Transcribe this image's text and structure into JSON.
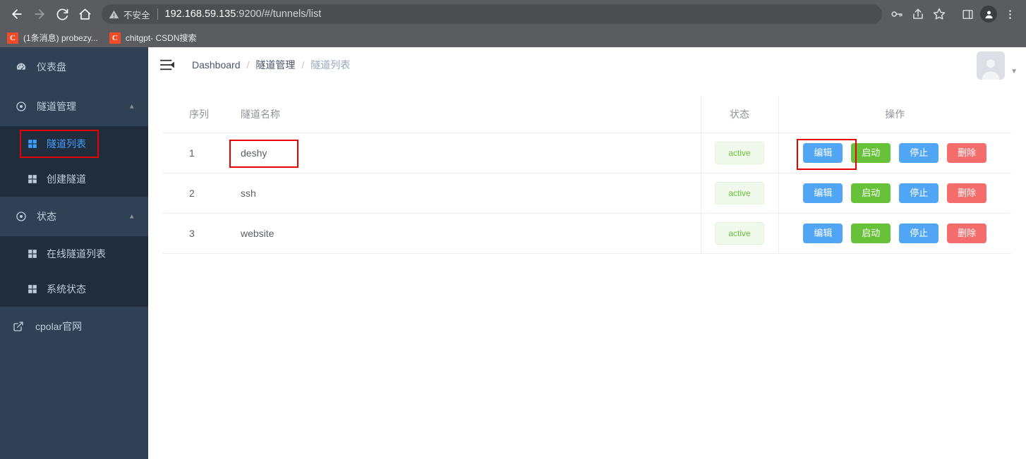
{
  "browser": {
    "nav": {
      "back": "back-arrow",
      "forward": "forward-arrow",
      "reload": "reload",
      "home": "home"
    },
    "omnibox": {
      "security_label": "不安全",
      "url_host": "192.168.59.135",
      "url_path": ":9200/#/tunnels/list"
    },
    "toolbar_icons": [
      "key-icon",
      "share-icon",
      "star-icon",
      "sidepanel-icon",
      "profile-icon",
      "more-menu-icon"
    ],
    "bookmarks": [
      {
        "favicon_letter": "C",
        "title": "(1条消息) probezy..."
      },
      {
        "favicon_letter": "C",
        "title": "chitgpt- CSDN搜索"
      }
    ]
  },
  "sidebar": {
    "items": [
      {
        "label": "仪表盘",
        "icon": "dashboard-icon",
        "type": "item"
      },
      {
        "label": "隧道管理",
        "icon": "tunnel-icon",
        "type": "group",
        "expanded": true
      },
      {
        "label": "隧道列表",
        "icon": "grid-icon",
        "type": "sub",
        "active": true
      },
      {
        "label": "创建隧道",
        "icon": "grid-icon",
        "type": "sub",
        "active": false
      },
      {
        "label": "状态",
        "icon": "tunnel-icon",
        "type": "group",
        "expanded": true
      },
      {
        "label": "在线隧道列表",
        "icon": "grid-icon",
        "type": "sub",
        "active": false
      },
      {
        "label": "系统状态",
        "icon": "grid-icon",
        "type": "sub",
        "active": false
      },
      {
        "label": "cpolar官网",
        "icon": "external-link-icon",
        "type": "external"
      }
    ]
  },
  "navbar": {
    "hamburger": "hamburger-icon",
    "breadcrumb": [
      {
        "label": "Dashboard",
        "current": false
      },
      {
        "label": "隧道管理",
        "current": false
      },
      {
        "label": "隧道列表",
        "current": true
      }
    ],
    "separator": "/",
    "avatar": "user-avatar",
    "caret": "caret-down-icon"
  },
  "table": {
    "columns": [
      "序列",
      "隧道名称",
      "状态",
      "操作"
    ],
    "rows": [
      {
        "index": "1",
        "name": "deshy",
        "status": "active",
        "actions": [
          "编辑",
          "启动",
          "停止",
          "删除"
        ]
      },
      {
        "index": "2",
        "name": "ssh",
        "status": "active",
        "actions": [
          "编辑",
          "启动",
          "停止",
          "删除"
        ]
      },
      {
        "index": "3",
        "name": "website",
        "status": "active",
        "actions": [
          "编辑",
          "启动",
          "停止",
          "删除"
        ]
      }
    ]
  },
  "colors": {
    "sidebar_bg": "#304156",
    "submenu_bg": "#1f2d3d",
    "accent_blue": "#409eff",
    "button_primary": "#50a5f5",
    "button_success": "#67c23a",
    "button_danger": "#f56c6c",
    "tag_active_text": "#67c23a",
    "tag_active_bg": "#f0f9eb",
    "annotation_red": "#e60000"
  }
}
